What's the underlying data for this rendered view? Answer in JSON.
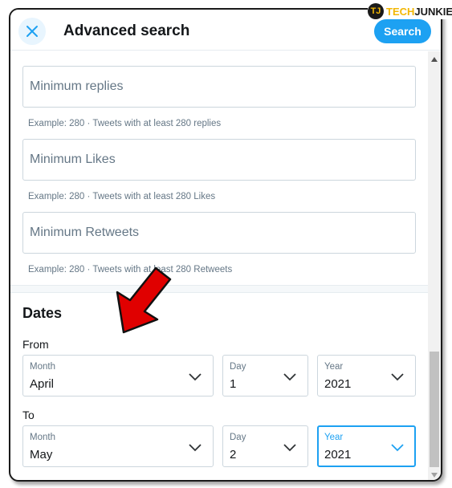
{
  "watermark": {
    "brand_part1": "TECH",
    "brand_part2": "JUNKIE",
    "mark": "TJ"
  },
  "header": {
    "title": "Advanced search",
    "search_label": "Search",
    "close_icon": "close-icon"
  },
  "engagement": {
    "fields": [
      {
        "placeholder": "Minimum replies",
        "hint": "Example: 280 · Tweets with at least 280 replies"
      },
      {
        "placeholder": "Minimum Likes",
        "hint": "Example: 280 · Tweets with at least 280 Likes"
      },
      {
        "placeholder": "Minimum Retweets",
        "hint": "Example: 280 · Tweets with at least 280 Retweets"
      }
    ]
  },
  "dates": {
    "title": "Dates",
    "from": {
      "label": "From",
      "month": {
        "label": "Month",
        "value": "April"
      },
      "day": {
        "label": "Day",
        "value": "1"
      },
      "year": {
        "label": "Year",
        "value": "2021"
      }
    },
    "to": {
      "label": "To",
      "month": {
        "label": "Month",
        "value": "May"
      },
      "day": {
        "label": "Day",
        "value": "2"
      },
      "year": {
        "label": "Year",
        "value": "2021"
      }
    }
  },
  "colors": {
    "accent": "#1da1f2",
    "annotation_arrow": "#e00000",
    "brand_yellow": "#f2b705"
  }
}
